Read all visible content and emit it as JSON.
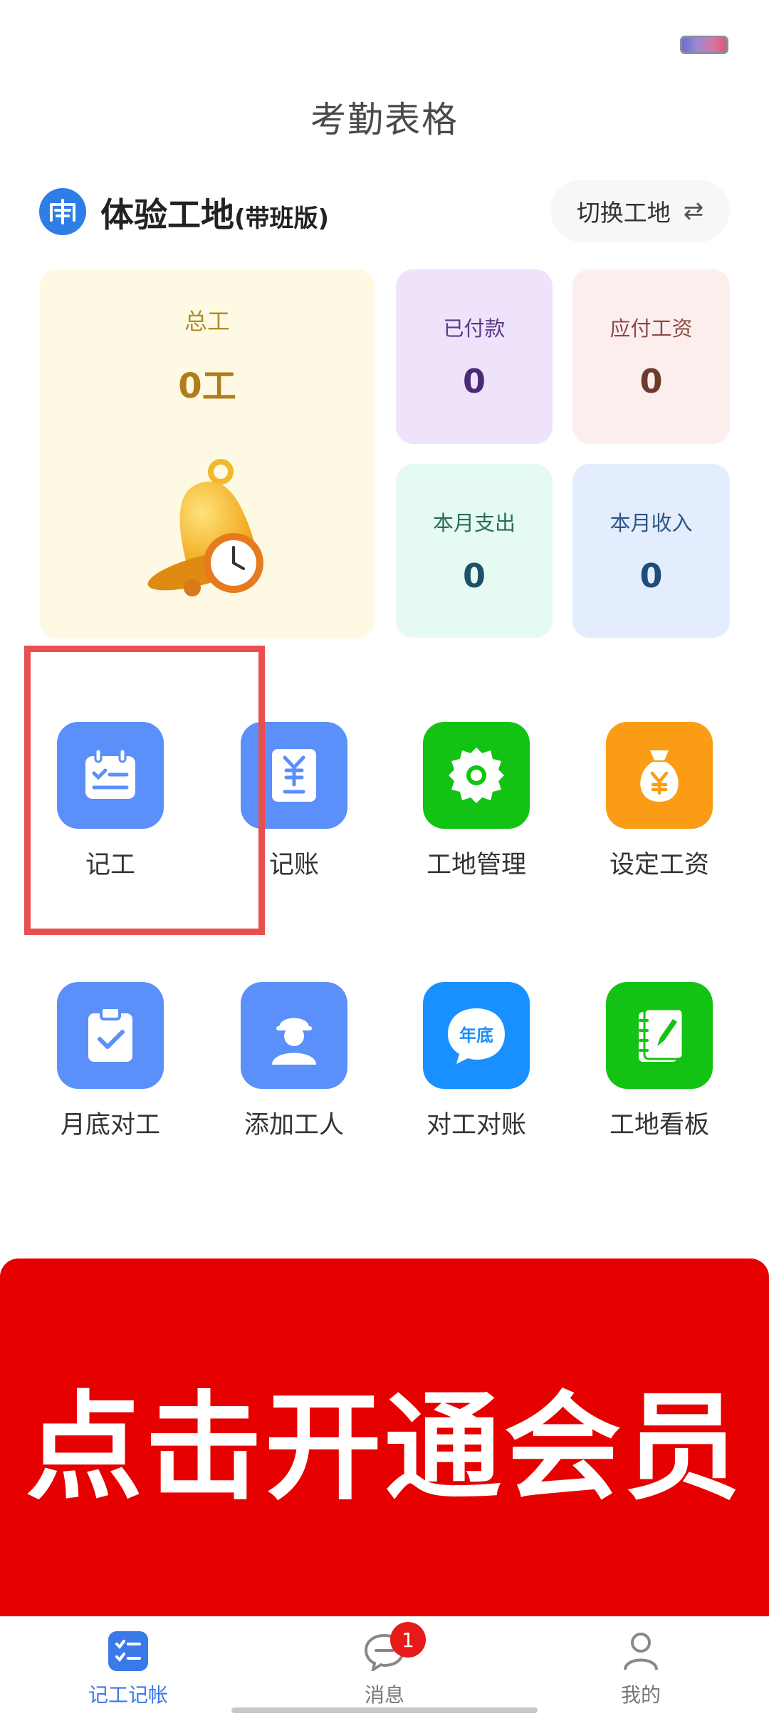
{
  "header": {
    "title": "考勤表格"
  },
  "site": {
    "name": "体验工地",
    "edition": "(带班版)",
    "switch_label": "切换工地"
  },
  "stats": {
    "total": {
      "label": "总工",
      "value": "0工"
    },
    "paid": {
      "label": "已付款",
      "value": "0"
    },
    "wage_due": {
      "label": "应付工资",
      "value": "0"
    },
    "month_expense": {
      "label": "本月支出",
      "value": "0"
    },
    "month_income": {
      "label": "本月收入",
      "value": "0"
    }
  },
  "grid": {
    "items": [
      {
        "label": "记工",
        "icon": "calendar-check-icon",
        "color": "#5b8ff9"
      },
      {
        "label": "记账",
        "icon": "yuan-note-icon",
        "color": "#5b8ff9"
      },
      {
        "label": "工地管理",
        "icon": "gear-icon",
        "color": "#13c313"
      },
      {
        "label": "设定工资",
        "icon": "money-bag-icon",
        "color": "#fa9d14"
      },
      {
        "label": "月底对工",
        "icon": "clipboard-check-icon",
        "color": "#5b8ff9"
      },
      {
        "label": "添加工人",
        "icon": "worker-helmet-icon",
        "color": "#5b8ff9"
      },
      {
        "label": "对工对账",
        "icon": "year-end-chat-icon",
        "color": "#1890ff"
      },
      {
        "label": "工地看板",
        "icon": "notebook-pen-icon",
        "color": "#13c313"
      }
    ]
  },
  "banner": {
    "text": "点击开通会员"
  },
  "tabbar": {
    "items": [
      {
        "label": "记工记帐",
        "active": true
      },
      {
        "label": "消息",
        "active": false,
        "badge": "1"
      },
      {
        "label": "我的",
        "active": false
      }
    ]
  }
}
